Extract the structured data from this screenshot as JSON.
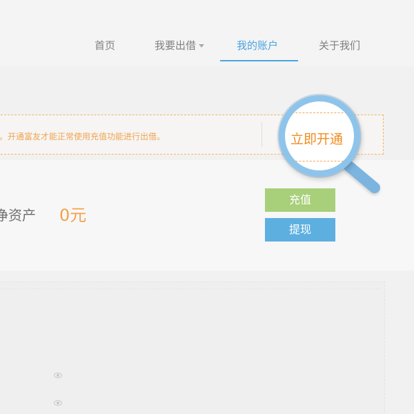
{
  "nav": {
    "items": [
      {
        "label": "首页"
      },
      {
        "label": "我要出借"
      },
      {
        "label": "我的账户"
      },
      {
        "label": "关于我们"
      }
    ],
    "active_index": 2
  },
  "notice": {
    "text": "。开通富友才能正常使用充值功能进行出借。",
    "action_label": "立即开通"
  },
  "account": {
    "asset_label": "净资产",
    "asset_value": "0元",
    "recharge_label": "充值",
    "withdraw_label": "提现"
  },
  "colors": {
    "accent_blue": "#4aa3df",
    "notice_orange": "#f0a451",
    "recharge_green": "#a8cf7a",
    "withdraw_blue": "#5dafe0"
  },
  "icons": [
    "caret-down-icon",
    "eye-icon",
    "magnifier-icon"
  ]
}
